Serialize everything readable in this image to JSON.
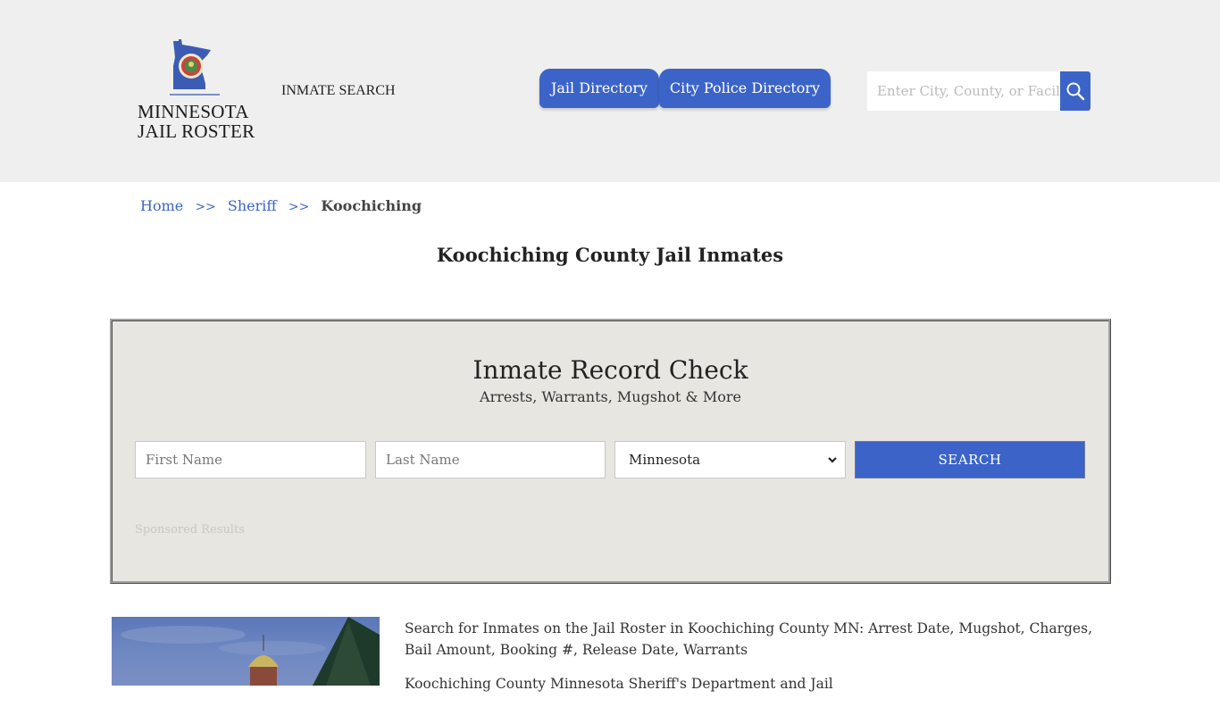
{
  "header": {
    "logo": {
      "line1": "MINNESOTA",
      "line2": "JAIL ROSTER",
      "icon": "minnesota-state-seal-map-icon"
    },
    "inmate_search_link": "INMATE SEARCH",
    "nav": [
      {
        "label": "Jail Directory"
      },
      {
        "label": "City Police Directory"
      }
    ],
    "search": {
      "placeholder": "Enter City, County, or Facility",
      "button_icon": "search-icon"
    }
  },
  "breadcrumb": {
    "items": [
      {
        "label": "Home"
      },
      {
        "label": "Sheriff"
      }
    ],
    "separator": ">>",
    "current": "Koochiching"
  },
  "page": {
    "title": "Koochiching County Jail Inmates"
  },
  "record_check": {
    "title": "Inmate Record Check",
    "subtitle": "Arrests, Warrants, Mugshot & More",
    "first_name_placeholder": "First Name",
    "last_name_placeholder": "Last Name",
    "state_selected": "Minnesota",
    "search_label": "SEARCH",
    "sponsored": "Sponsored Results"
  },
  "content": {
    "paragraph1": "Search for Inmates on the Jail Roster in Koochiching County MN: Arrest Date, Mugshot, Charges, Bail Amount, Booking #, Release Date, Warrants",
    "paragraph2": "Koochiching County Minnesota Sheriff's Department and Jail"
  },
  "colors": {
    "accent": "#3c64c8",
    "header_bg": "#efefef",
    "box_bg": "#e8e6e1"
  }
}
